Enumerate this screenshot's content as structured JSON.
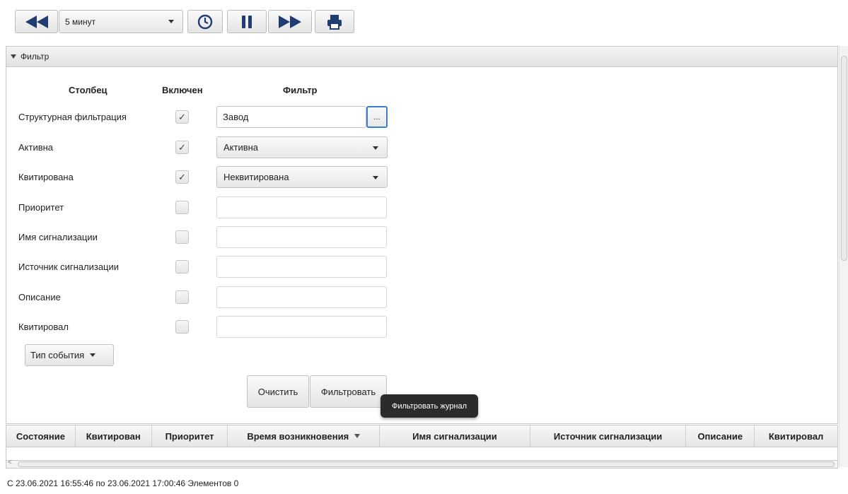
{
  "toolbar": {
    "back_icon": "rewind-icon",
    "interval_value": "5 минут",
    "clock_icon": "clock-icon",
    "pause_icon": "pause-icon",
    "forward_icon": "fast-forward-icon",
    "print_icon": "printer-icon"
  },
  "filter": {
    "title": "Фильтр",
    "headers": {
      "column": "Столбец",
      "enabled": "Включен",
      "filter": "Фильтр"
    },
    "rows": [
      {
        "label": "Структурная фильтрация",
        "checked": true,
        "value": "Завод",
        "button_label": "..."
      },
      {
        "label": "Активна",
        "checked": true,
        "value": "Активна"
      },
      {
        "label": "Квитирована",
        "checked": true,
        "value": "Неквитирована"
      },
      {
        "label": "Приоритет",
        "checked": false,
        "value": ""
      },
      {
        "label": "Имя сигнализации",
        "checked": false,
        "value": ""
      },
      {
        "label": "Источник сигнализации",
        "checked": false,
        "value": ""
      },
      {
        "label": "Описание",
        "checked": false,
        "value": ""
      },
      {
        "label": "Квитировал",
        "checked": false,
        "value": ""
      }
    ],
    "event_type_label": "Тип события",
    "clear_label": "Очистить",
    "apply_label": "Фильтровать",
    "tooltip": "Фильтровать журнал"
  },
  "table": {
    "columns": [
      "Состояние",
      "Квитирован",
      "Приоритет",
      "Время возникновения",
      "Имя сигнализации",
      "Источник сигнализации",
      "Описание",
      "Квитировал"
    ],
    "sorted_column": "Время возникновения"
  },
  "status": "С 23.06.2021 16:55:46 по 23.06.2021 17:00:46 Элементов 0"
}
